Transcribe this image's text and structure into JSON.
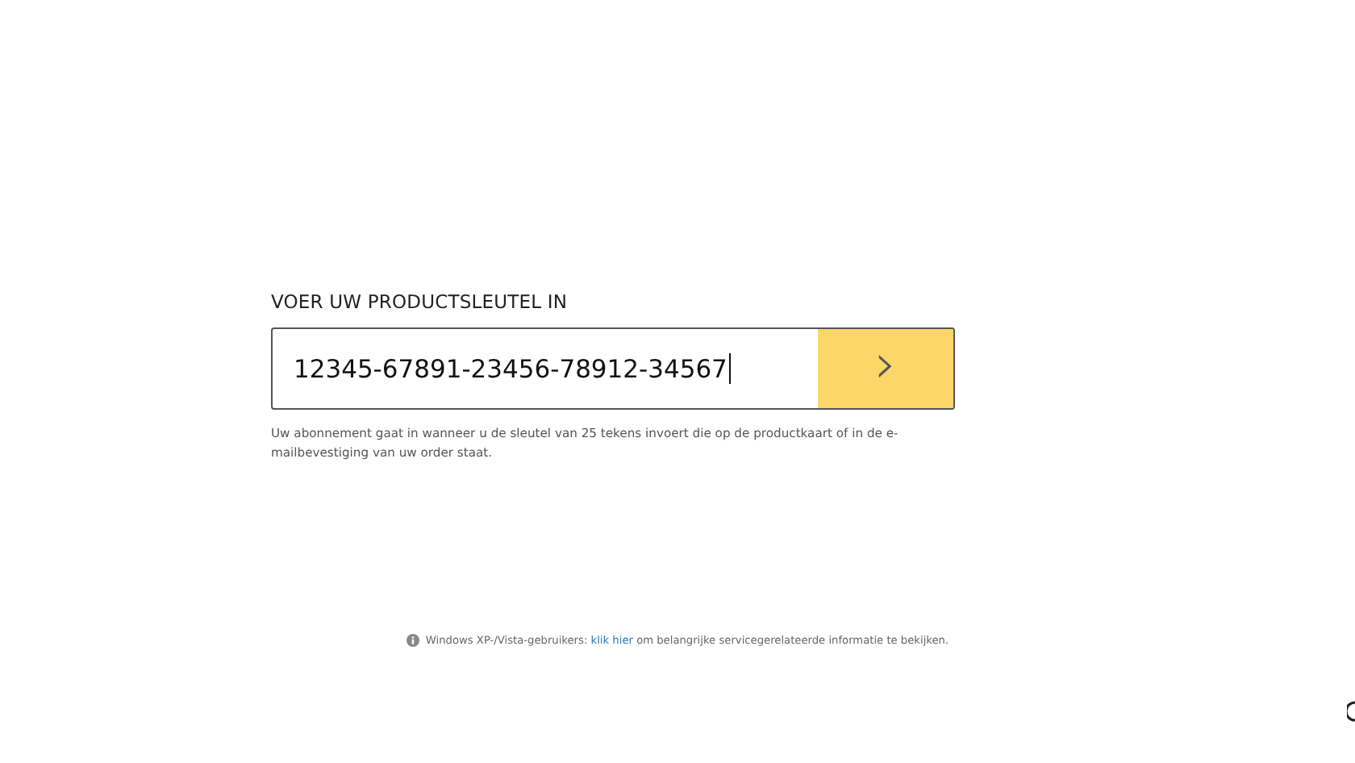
{
  "heading": "VOER UW PRODUCTSLEUTEL IN",
  "product_key": {
    "value": "12345-67891-23456-78912-34567",
    "focused": true
  },
  "submit_button": {
    "label": "›"
  },
  "hint": "Uw abonnement gaat in wanneer u de sleutel van 25 tekens invoert die op de productkaart of in de e-mailbevestiging van uw order staat.",
  "footer_note": {
    "prefix": "Windows XP-/Vista-gebruikers: ",
    "link": "klik hier",
    "suffix": " om belangrijke servicegerelateerde informatie te bekijken."
  }
}
